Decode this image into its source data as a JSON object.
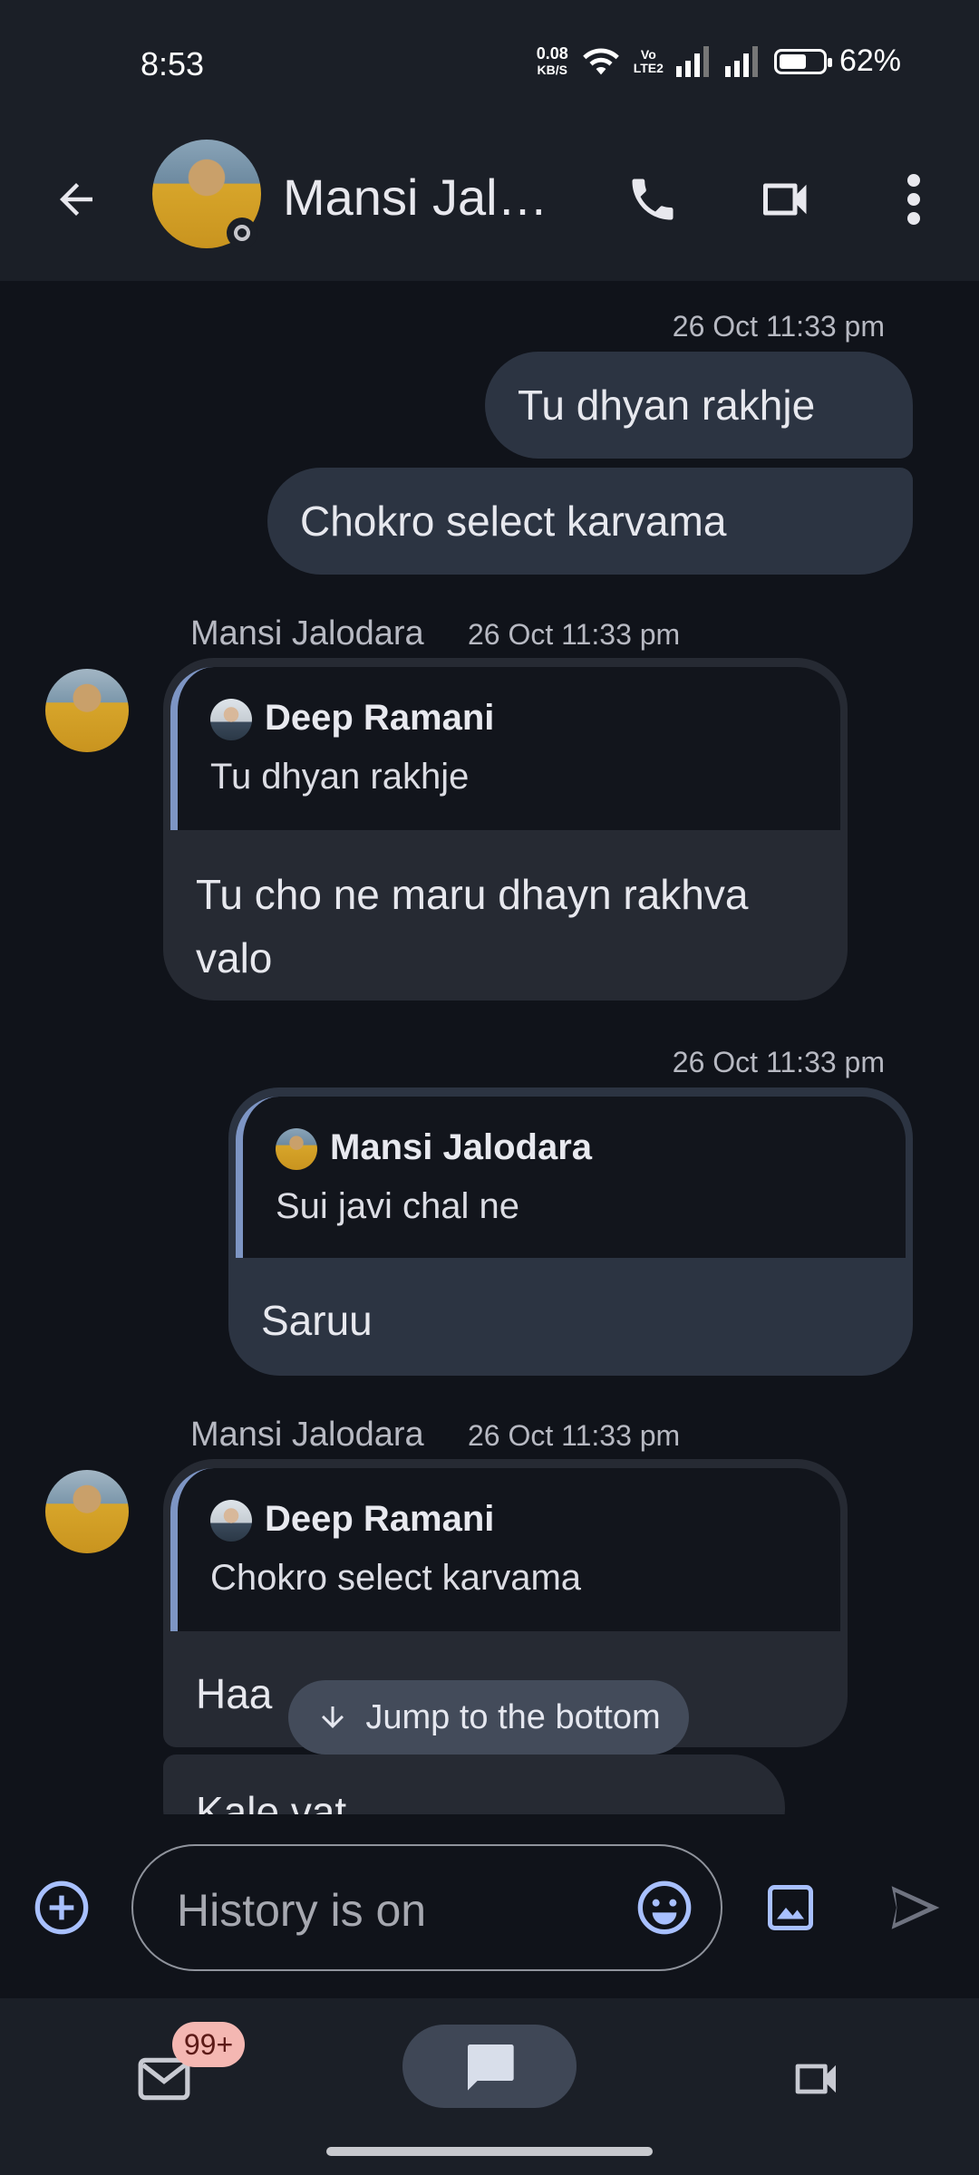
{
  "status_bar": {
    "time": "8:53",
    "net_speed_value": "0.08",
    "net_speed_unit": "KB/S",
    "volte_top": "Vo",
    "volte_bottom": "LTE2",
    "battery_percent": "62%",
    "battery_level": 0.62
  },
  "app_bar": {
    "title": "Mansi Jalo…",
    "icons": [
      "back-arrow-icon",
      "phone-icon",
      "video-call-icon",
      "more-vert-icon"
    ]
  },
  "messages": {
    "m1": {
      "timestamp": "26 Oct 11:33 pm",
      "text_a": "Tu dhyan rakhje",
      "text_b": "Chokro select karvama"
    },
    "m2": {
      "sender": "Mansi Jalodara",
      "timestamp": "26 Oct 11:33 pm",
      "quote_author": "Deep Ramani",
      "quote_text": "Tu dhyan rakhje",
      "text_line1": "Tu cho ne maru dhayn rakhva",
      "text_line2": "valo"
    },
    "m3": {
      "timestamp": "26 Oct 11:33 pm",
      "quote_author": "Mansi Jalodara",
      "quote_text": "Sui javi chal ne",
      "text": "Saruu"
    },
    "m4": {
      "sender": "Mansi Jalodara",
      "timestamp": "26 Oct 11:33 pm",
      "quote_author": "Deep Ramani",
      "quote_text": "Chokro select karvama",
      "text": "Haa",
      "next_text": "Kale vat"
    }
  },
  "jump_button": {
    "label": "Jump to the bottom"
  },
  "composer": {
    "placeholder": "History is on"
  },
  "bottom_nav": {
    "mail_badge": "99+"
  },
  "colors": {
    "background": "#10131a",
    "bar": "#1b1f27",
    "outgoing_bubble": "#2c3442",
    "incoming_bubble": "#262a33",
    "quote_accent": "#7d95c4",
    "accent_icon": "#a8c0ff",
    "badge": "#f4b7b2"
  }
}
